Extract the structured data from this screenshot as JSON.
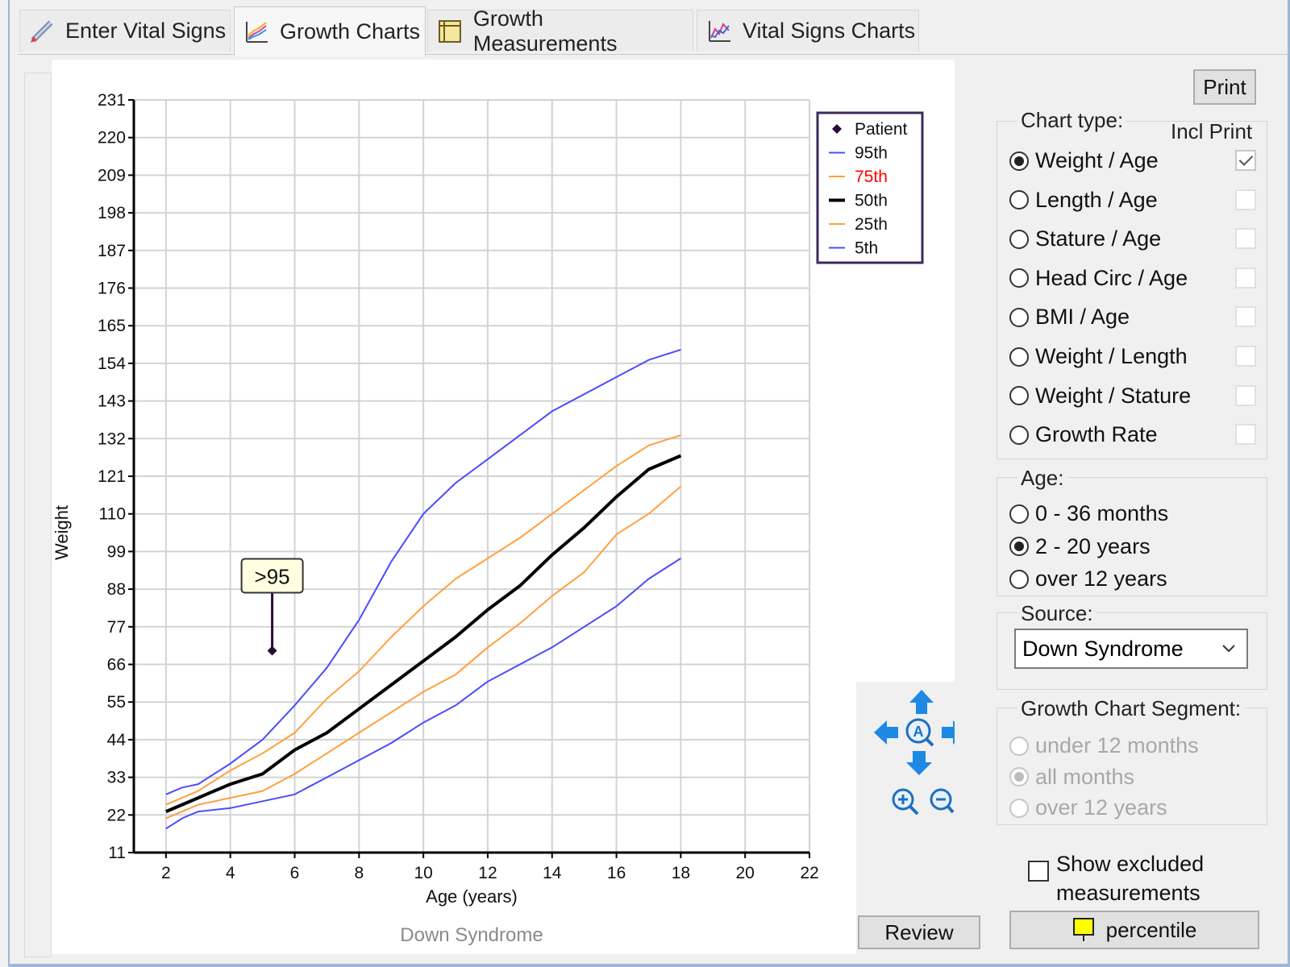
{
  "tabs": [
    {
      "label": "Enter Vital Signs",
      "icon": "pencil-icon"
    },
    {
      "label": "Growth Charts",
      "icon": "growth-chart-icon"
    },
    {
      "label": "Growth Measurements",
      "icon": "ruler-icon"
    },
    {
      "label": "Vital Signs Charts",
      "icon": "line-chart-icon"
    }
  ],
  "chart_data": {
    "type": "line",
    "footer_label": "Down Syndrome",
    "xlabel": "Age (years)",
    "ylabel": "Weight",
    "xlim": [
      1,
      22
    ],
    "ylim": [
      11,
      231
    ],
    "x_ticks": [
      2,
      4,
      6,
      8,
      10,
      12,
      14,
      16,
      18,
      20,
      22
    ],
    "y_ticks": [
      11,
      22,
      33,
      44,
      55,
      66,
      77,
      88,
      99,
      110,
      121,
      132,
      143,
      154,
      165,
      176,
      187,
      198,
      209,
      220,
      231
    ],
    "grid": true,
    "legend": "top-right",
    "series": [
      {
        "name": "95th",
        "color": "#4b4bff",
        "width": 2,
        "x": [
          2,
          2.5,
          3,
          4,
          5,
          6,
          7,
          8,
          9,
          10,
          11,
          12,
          13,
          14,
          15,
          16,
          17,
          18
        ],
        "y": [
          28,
          30,
          31,
          37,
          44,
          54,
          65,
          79,
          96,
          110,
          119,
          126,
          133,
          140,
          145,
          150,
          155,
          158
        ]
      },
      {
        "name": "75th",
        "color": "#ffa040",
        "label_color": "#ff0000",
        "width": 2,
        "x": [
          2,
          2.5,
          3,
          4,
          5,
          6,
          7,
          8,
          9,
          10,
          11,
          12,
          13,
          14,
          15,
          16,
          17,
          18
        ],
        "y": [
          25,
          27,
          29,
          35,
          40,
          46,
          56,
          64,
          74,
          83,
          91,
          97,
          103,
          110,
          117,
          124,
          130,
          133
        ]
      },
      {
        "name": "50th",
        "color": "#000000",
        "width": 4,
        "x": [
          2,
          2.5,
          3,
          4,
          5,
          6,
          7,
          8,
          9,
          10,
          11,
          12,
          13,
          14,
          15,
          16,
          17,
          18
        ],
        "y": [
          23,
          25,
          27,
          31,
          34,
          41,
          46,
          53,
          60,
          67,
          74,
          82,
          89,
          98,
          106,
          115,
          123,
          127
        ]
      },
      {
        "name": "25th",
        "color": "#ffa040",
        "width": 2,
        "x": [
          2,
          2.5,
          3,
          4,
          5,
          6,
          7,
          8,
          9,
          10,
          11,
          12,
          13,
          14,
          15,
          16,
          17,
          18
        ],
        "y": [
          21,
          23,
          25,
          27,
          29,
          34,
          40,
          46,
          52,
          58,
          63,
          71,
          78,
          86,
          93,
          104,
          110,
          118
        ]
      },
      {
        "name": "5th",
        "color": "#4b4bff",
        "width": 2,
        "x": [
          2,
          2.5,
          3,
          4,
          5,
          6,
          7,
          8,
          9,
          10,
          11,
          12,
          13,
          14,
          15,
          16,
          17,
          18
        ],
        "y": [
          18,
          21,
          23,
          24,
          26,
          28,
          33,
          38,
          43,
          49,
          54,
          61,
          66,
          71,
          77,
          83,
          91,
          97
        ]
      }
    ],
    "patient": {
      "name": "Patient",
      "color": "#2b0a3a",
      "x": [
        5.3
      ],
      "y": [
        70
      ]
    },
    "annotation": {
      "text": ">95",
      "x": 5.3,
      "y": 70
    }
  },
  "panel": {
    "print_label": "Print",
    "chart_type_title": "Chart type:",
    "incl_print_title": "Incl Print",
    "chart_types": [
      {
        "label": "Weight / Age",
        "selected": true,
        "incl_print": true
      },
      {
        "label": "Length / Age",
        "selected": false,
        "incl_print": false
      },
      {
        "label": "Stature / Age",
        "selected": false,
        "incl_print": false
      },
      {
        "label": "Head Circ / Age",
        "selected": false,
        "incl_print": false
      },
      {
        "label": "BMI / Age",
        "selected": false,
        "incl_print": false
      },
      {
        "label": "Weight / Length",
        "selected": false,
        "incl_print": false
      },
      {
        "label": "Weight / Stature",
        "selected": false,
        "incl_print": false
      },
      {
        "label": "Growth Rate",
        "selected": false,
        "incl_print": false
      }
    ],
    "age_title": "Age:",
    "ages": [
      {
        "label": "0 - 36 months",
        "selected": false
      },
      {
        "label": "2 - 20 years",
        "selected": true
      },
      {
        "label": "over 12 years",
        "selected": false
      }
    ],
    "source_title": "Source:",
    "source_value": "Down Syndrome",
    "segment_title": "Growth Chart Segment:",
    "segments": [
      {
        "label": "under 12 months",
        "selected": false
      },
      {
        "label": "all months",
        "selected": true
      },
      {
        "label": "over 12 years",
        "selected": false
      }
    ],
    "show_excluded_label": "Show excluded measurements",
    "percentile_label": "percentile",
    "review_label": "Review"
  },
  "colors": {
    "accent_blue": "#1e88e5",
    "grid": "#d3d3d3",
    "patient": "#2b0a3a",
    "legend_border": "#3d2a5c"
  }
}
